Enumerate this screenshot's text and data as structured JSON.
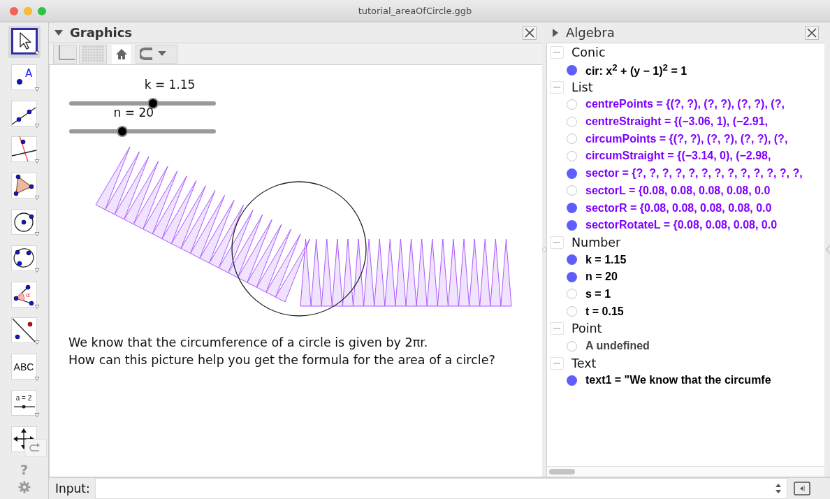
{
  "window": {
    "title": "tutorial_areaOfCircle.ggb"
  },
  "toolbox": {
    "tools": [
      {
        "kind": "move",
        "selected": true
      },
      {
        "kind": "point",
        "label": "A",
        "selected": false
      },
      {
        "kind": "line",
        "selected": false
      },
      {
        "kind": "perpendicular",
        "selected": false
      },
      {
        "kind": "polygon",
        "selected": false
      },
      {
        "kind": "circle",
        "selected": false
      },
      {
        "kind": "conic",
        "selected": false
      },
      {
        "kind": "angle",
        "label": "α",
        "selected": false
      },
      {
        "kind": "reflect",
        "selected": false
      },
      {
        "kind": "text",
        "label": "ABC",
        "selected": false
      },
      {
        "kind": "slider",
        "label": "a = 2",
        "selected": false
      },
      {
        "kind": "move_view",
        "selected": false
      }
    ],
    "help": "?"
  },
  "graphics": {
    "title": "Graphics",
    "style_bar_open": true,
    "toggles": [
      {
        "kind": "axes",
        "on": false
      },
      {
        "kind": "grid",
        "on": false
      }
    ],
    "sliders": [
      {
        "label": "k = 1.15",
        "level": 0.57
      },
      {
        "label": "n = 20",
        "level": 0.36
      }
    ],
    "text_lines": [
      "We know that the circumference of a circle is given by 2πr.",
      "How can this picture help you get the formula for the area of a circle?"
    ]
  },
  "algebra": {
    "title": "Algebra",
    "style_bar_open": false,
    "groups": [
      {
        "label": "Conic",
        "expanded": true,
        "items": [
          {
            "text": "cir: x$^{2}$ + (y − 1)$^{2}$ = 1",
            "shown": true,
            "color": "#000000"
          }
        ]
      },
      {
        "label": "List",
        "expanded": true,
        "items": [
          {
            "text": "centrePoints = {(?, ?), (?, ?), (?, ?), (?,",
            "shown": false,
            "color": "#7f00ff"
          },
          {
            "text": "centreStraight = {(−3.06, 1), (−2.91,",
            "shown": false,
            "color": "#7f00ff"
          },
          {
            "text": "circumPoints = {(?, ?), (?, ?), (?, ?), (?,",
            "shown": false,
            "color": "#7f00ff"
          },
          {
            "text": "circumStraight = {(−3.14, 0), (−2.98,",
            "shown": false,
            "color": "#7f00ff"
          },
          {
            "text": "sector = {?, ?, ?, ?, ?, ?, ?, ?, ?, ?, ?, ?, ?,",
            "shown": true,
            "color": "#7f00ff"
          },
          {
            "text": "sectorL = {0.08, 0.08, 0.08, 0.08, 0.0",
            "shown": false,
            "color": "#7f00ff"
          },
          {
            "text": "sectorR = {0.08, 0.08, 0.08, 0.08, 0.0",
            "shown": true,
            "color": "#7f00ff"
          },
          {
            "text": "sectorRotateL = {0.08, 0.08, 0.08, 0.0",
            "shown": true,
            "color": "#7f00ff"
          }
        ]
      },
      {
        "label": "Number",
        "expanded": true,
        "items": [
          {
            "text": "k = 1.15",
            "shown": true,
            "color": "#000000"
          },
          {
            "text": "n = 20",
            "shown": true,
            "color": "#000000"
          },
          {
            "text": "s = 1",
            "shown": false,
            "color": "#000000"
          },
          {
            "text": "t = 0.15",
            "shown": false,
            "color": "#000000"
          }
        ]
      },
      {
        "label": "Point",
        "expanded": true,
        "items": [
          {
            "text": "A undefined",
            "shown": false,
            "color": "#444444"
          }
        ]
      },
      {
        "label": "Text",
        "expanded": true,
        "items": [
          {
            "text": "text1 = \"We know that the circumfe",
            "shown": true,
            "color": "#000000"
          }
        ]
      }
    ]
  },
  "input": {
    "label": "Input:"
  }
}
